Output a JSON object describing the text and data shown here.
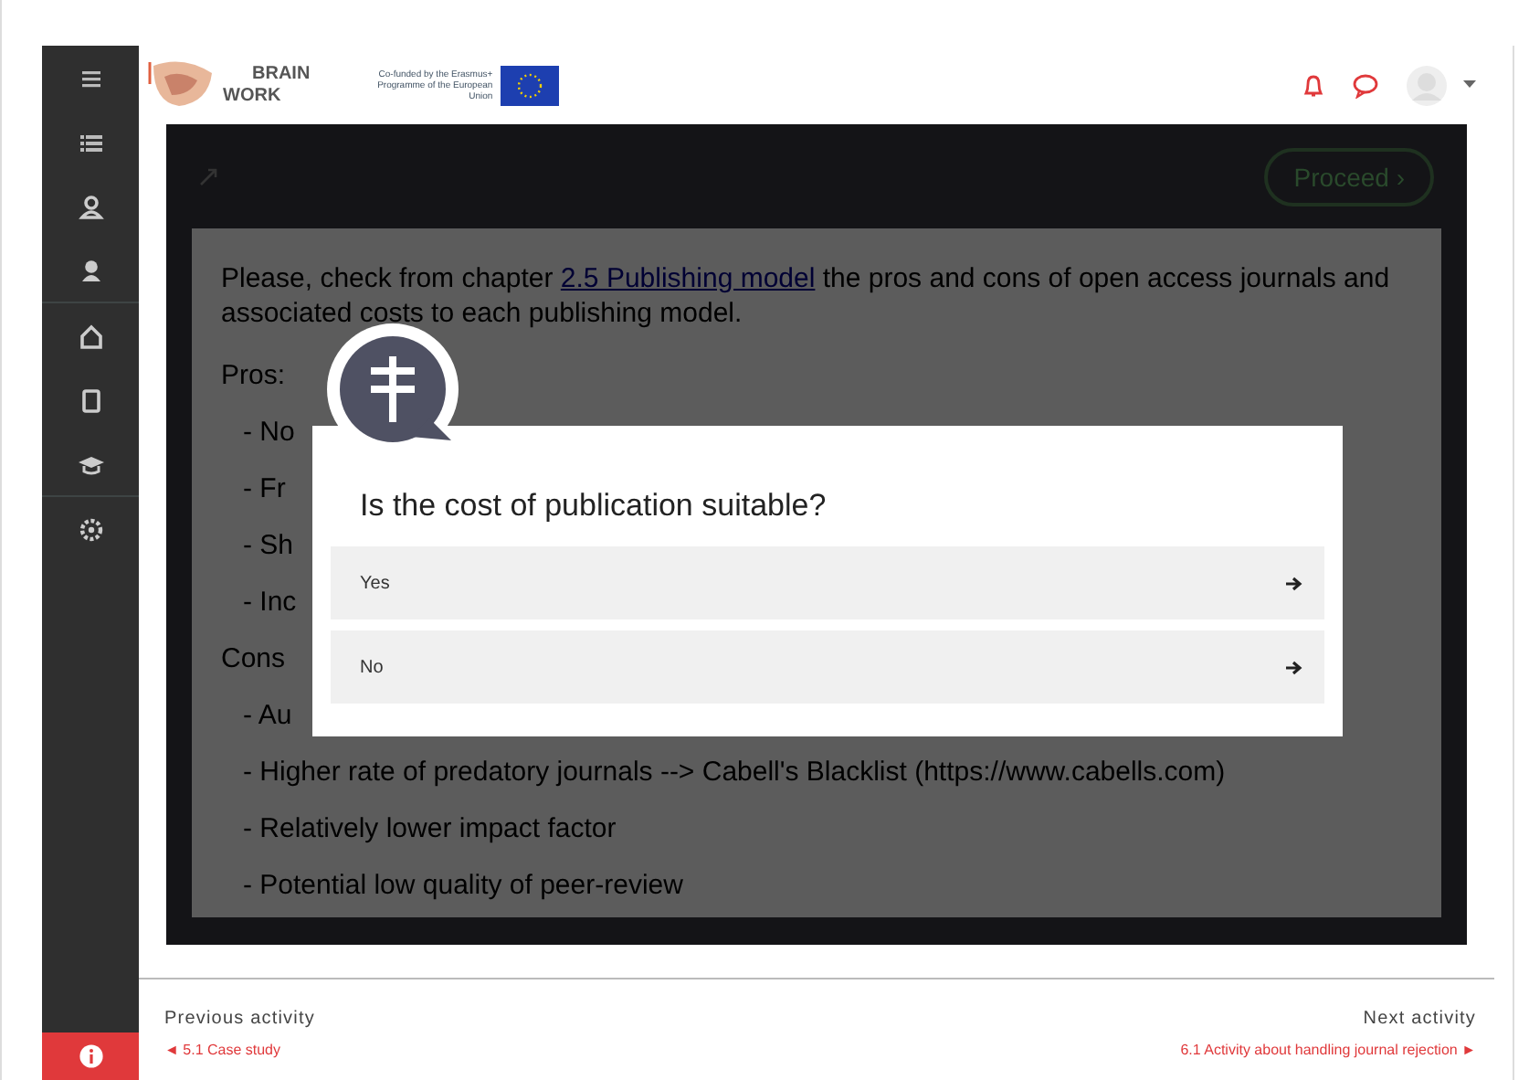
{
  "header": {
    "logo_top": "BRAIN",
    "logo_bottom": "WORK",
    "eu_text": "Co-funded by the Erasmus+ Programme of the European Union"
  },
  "activity": {
    "proceed": "Proceed ›",
    "intro_start": "Please, check from chapter ",
    "intro_link": "2.5 Publishing model",
    "intro_end": " the pros and cons of open access journals and associated costs to each publishing model.",
    "lines": [
      {
        "kind": "heading",
        "text": "Pros:"
      },
      {
        "kind": "bullet",
        "text": "- No"
      },
      {
        "kind": "bullet",
        "text": "- Fr"
      },
      {
        "kind": "bullet",
        "text": "- Sh"
      },
      {
        "kind": "bullet",
        "text": "- Inc"
      },
      {
        "kind": "heading",
        "text": "Cons"
      },
      {
        "kind": "bullet",
        "text": "- Au"
      },
      {
        "kind": "bullet",
        "text": "- Higher rate of predatory journals --> Cabell's Blacklist (https://www.cabells.com)"
      },
      {
        "kind": "bullet",
        "text": "- Relatively lower impact factor"
      },
      {
        "kind": "bullet",
        "text": "- Potential low quality of peer-review"
      }
    ]
  },
  "dialog": {
    "question": "Is the cost of publication suitable?",
    "options": [
      {
        "label": "Yes"
      },
      {
        "label": "No"
      }
    ]
  },
  "footer": {
    "previous_heading": "Previous activity",
    "previous_link": "◄ 5.1 Case study",
    "next_heading": "Next activity",
    "next_link": "6.1 Activity about handling journal rejection ►"
  }
}
